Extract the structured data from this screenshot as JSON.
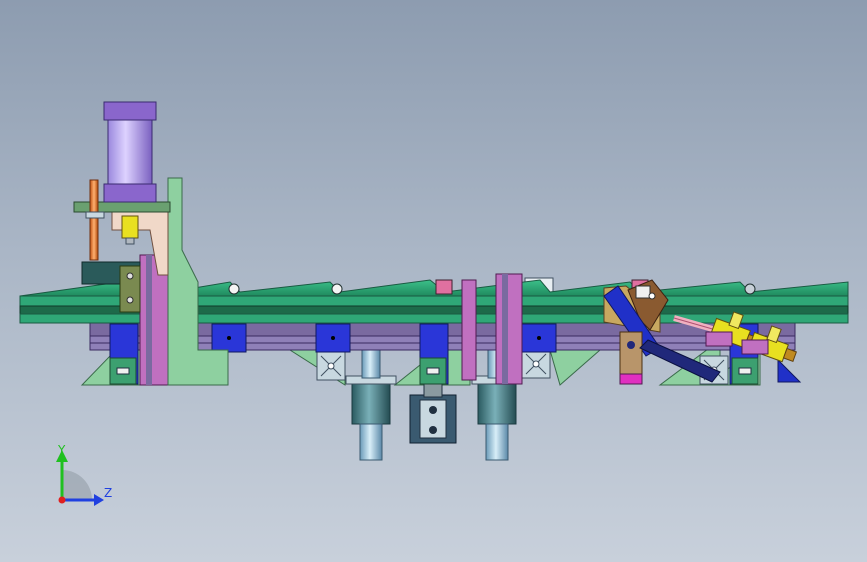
{
  "viewport": {
    "background_top": "#8d9cb0",
    "background_bottom": "#c8d0db"
  },
  "model": {
    "colors": {
      "rail_green": "#2fa777",
      "rail_dark": "#1a5a42",
      "purple_frame": "#7a6aa0",
      "magenta": "#c070c0",
      "blue_block": "#2a36d8",
      "extrusion": "#b8c8d0",
      "cylinder_purple": "#8a66cc",
      "cylinder_tube": "#b8a8e8",
      "steel_teal": "#3a7a82",
      "steel_light": "#9ec8e0",
      "bracket_green": "#8ed0a0",
      "orange_rod": "#e06a20",
      "yellow_fitting": "#e8e020",
      "tan_plate": "#c8a860",
      "brown_plate": "#8a5a30",
      "dark_navy": "#20287a",
      "pink_hose": "#f0b0c0"
    }
  },
  "triad": {
    "y_label": "Y",
    "z_label": "Z",
    "y_color": "#20c020",
    "z_color": "#2040e0",
    "origin_color": "#e02020"
  }
}
